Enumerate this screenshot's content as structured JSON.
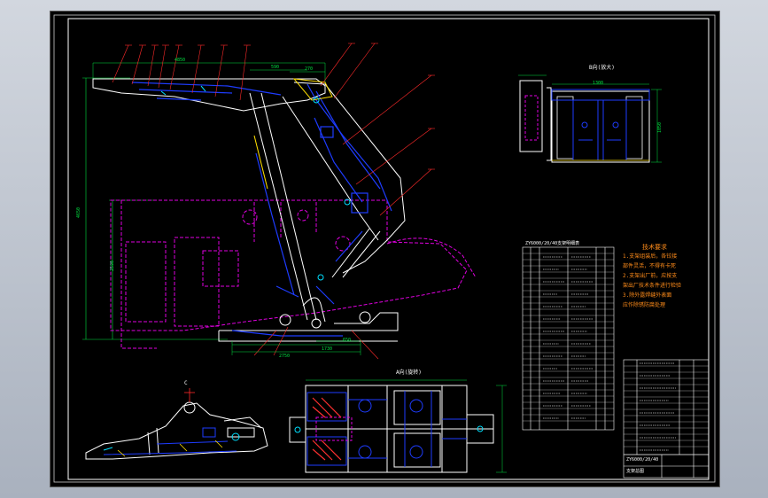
{
  "colors": {
    "background": "#000000",
    "frame": "#ffffff",
    "outline": "#ffffff",
    "hidden": "#1e3cff",
    "phantom": "#e000e0",
    "dimension": "#00e040",
    "leader": "#ff2a2a",
    "notes": "#ff8c1a",
    "cyan": "#00e0ff",
    "yellow": "#ffe000"
  },
  "view_labels": {
    "side_view_b": "B向(放大)",
    "top_view_a": "A向(旋转)",
    "detail_view": "C"
  },
  "dimensions": {
    "top_overall": "4850",
    "top_mid": "590",
    "top_small": "270",
    "bottom_1": "1730",
    "bottom_2": "2750",
    "bottom_3": "650",
    "left_vertical": "2590",
    "left_height": "4650",
    "right_view_w": "1300",
    "right_view_h": "1050"
  },
  "tech_requirements": {
    "title": "技术要求",
    "items": [
      "1.支架组装后，各铰接",
      "部件灵活，不得有卡死",
      "2.支架出厂前，应按支",
      "架出厂技术条件进行检验",
      "3.除外露焊缝外表面",
      "应作除锈防腐处理"
    ]
  },
  "parts_list_title": "ZY6000/20/40支架明细表",
  "title_block": {
    "drawing_no": "ZY6000/20/40",
    "name": "支架总图"
  }
}
